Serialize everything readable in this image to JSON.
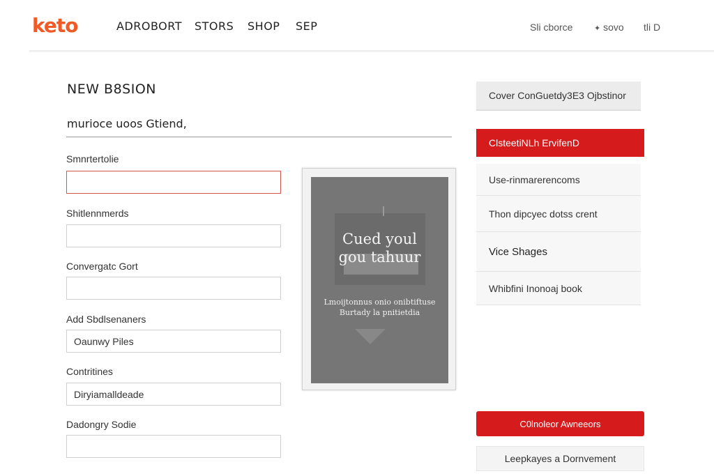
{
  "header": {
    "logo": "keto",
    "nav": [
      "ADROBORT",
      "STORS",
      "SHOP",
      "SEP"
    ],
    "utility_links": [
      "Sli cborce",
      "sovo",
      "tli D"
    ]
  },
  "form": {
    "title": "NEW B8SION",
    "subtitle": "murioce uoos Gtiend,",
    "fields": [
      {
        "label": "Smnrtertolie",
        "value": ""
      },
      {
        "label": "Shitlennmerds",
        "value": ""
      },
      {
        "label": "Convergatc Gort",
        "value": ""
      },
      {
        "label": "Add Sbdlsenaners",
        "value": "Oaunwy Piles"
      },
      {
        "label": "Contritines",
        "value": "Diryiamalldeade"
      },
      {
        "label": "Dadongry Sodie",
        "value": ""
      }
    ]
  },
  "preview": {
    "heading_line1": "Cued youl",
    "heading_line2": "gou tahuur",
    "text_line1": "Lmoijtonnus onio onibtiftuse",
    "text_line2": "Burtady la pnitietdia"
  },
  "sidebar": {
    "items": [
      "Cover ConGuetdy3E3 Ojbstinor",
      "ClsteetiNLh ErvifenD",
      "Use-rinmarerencoms",
      "Thon dipcyec dotss crent",
      "Vice Shages",
      "Whibfini Inonoaj book"
    ],
    "primary_button": "C0lnoleor Awneeors",
    "secondary_button": "Leepkayes a Dornvement"
  },
  "colors": {
    "brand": "#ef5a26",
    "accent_red": "#d51b1b",
    "preview_gray": "#767676"
  }
}
